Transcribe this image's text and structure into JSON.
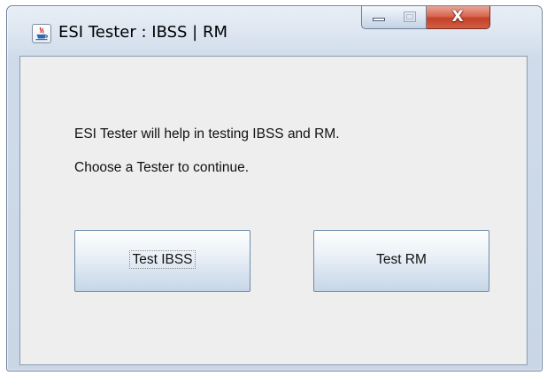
{
  "window": {
    "title": "ESI Tester : IBSS | RM",
    "close_glyph": "X",
    "icons": {
      "app": "java-cup-icon",
      "minimize": "minimize-icon",
      "maximize": "maximize-icon",
      "close": "close-icon"
    }
  },
  "content": {
    "line1": "ESI Tester will help in testing IBSS and RM.",
    "line2": "Choose a Tester to continue."
  },
  "buttons": {
    "ibss_label": "Test IBSS",
    "rm_label": "Test RM",
    "focused": "Test IBSS"
  },
  "colors": {
    "client_bg": "#eeeeee",
    "close_button": "#c3412a",
    "frame": "#cfdbea"
  }
}
